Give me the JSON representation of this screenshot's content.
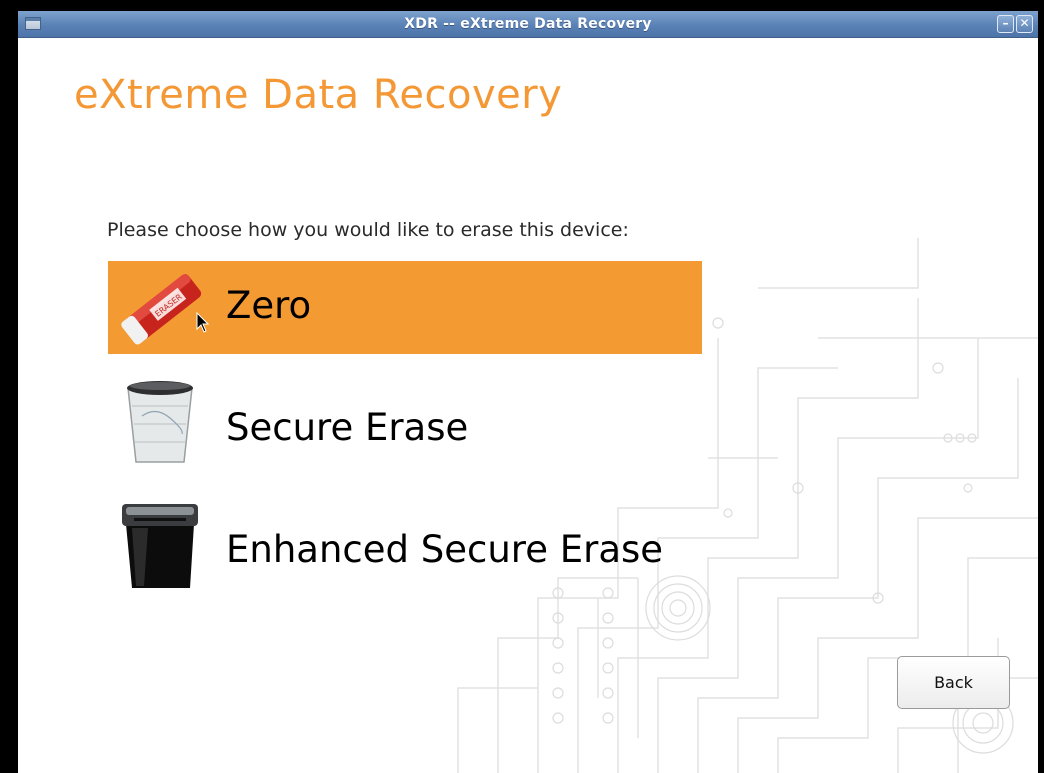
{
  "window": {
    "title": "XDR -- eXtreme Data Recovery",
    "minimize_glyph": "–",
    "close_glyph": "✕"
  },
  "app": {
    "heading": "eXtreme Data Recovery",
    "prompt": "Please choose how you would like to erase this device:",
    "options": [
      {
        "label": "Zero",
        "icon": "eraser-icon",
        "selected": true
      },
      {
        "label": "Secure Erase",
        "icon": "wastebasket-icon",
        "selected": false
      },
      {
        "label": "Enhanced Secure Erase",
        "icon": "paper-shredder-icon",
        "selected": false
      }
    ],
    "back_label": "Back"
  },
  "colors": {
    "accent": "#f49835",
    "selected_bg": "#f49a33",
    "titlebar": "#5a82b6"
  }
}
